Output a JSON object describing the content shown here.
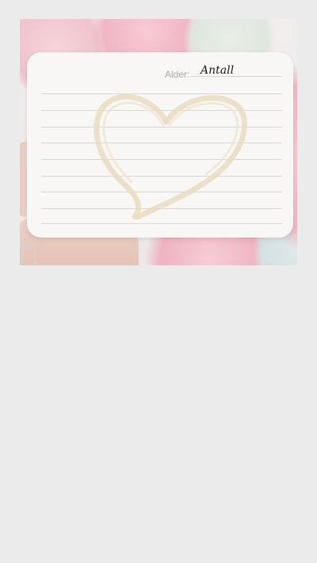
{
  "card": {
    "field_label": "Alder:",
    "field_value": "Antall",
    "line_count": 9
  },
  "colors": {
    "page_background": "#ebebeb",
    "card_paper": "#f8f7f5",
    "heart_stroke": "#eadcc0",
    "flower_pink": "#f3c6cf"
  },
  "icons": {
    "heart": "heart-icon"
  }
}
